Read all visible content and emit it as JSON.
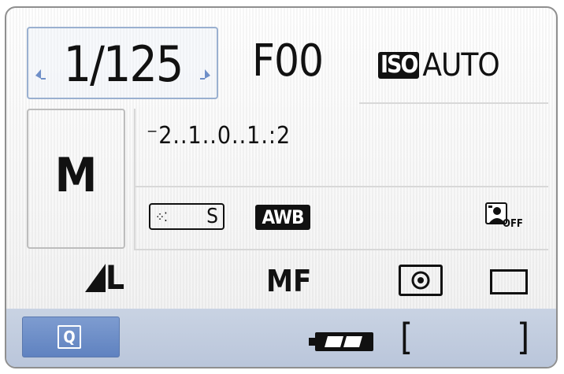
{
  "shutter": {
    "value": "1/125"
  },
  "aperture": {
    "value": "F00"
  },
  "iso": {
    "badge": "ISO",
    "value": "AUTO"
  },
  "mode": {
    "value": "M"
  },
  "exposure": {
    "scale": "⁻2..1..0..1.:2"
  },
  "picture_style": {
    "icon": "picture-style-icon",
    "value": "S"
  },
  "white_balance": {
    "value": "AWB"
  },
  "auto_lighting": {
    "icon": "auto-lighting-optimizer-icon",
    "state": "OFF"
  },
  "quality": {
    "icon": "quality-large-fine-icon",
    "value": "L"
  },
  "focus": {
    "value": "MF"
  },
  "metering": {
    "icon": "evaluative-metering-icon"
  },
  "drive": {
    "icon": "single-shooting-icon"
  },
  "quick_control": {
    "label": "Q"
  },
  "battery": {
    "icon": "battery-icon",
    "level": 1.0
  },
  "shots_remaining": {
    "open": "[",
    "close": "]"
  },
  "colors": {
    "accent": "#6f8fc8",
    "bar": "#c4cee0",
    "text": "#111111"
  }
}
